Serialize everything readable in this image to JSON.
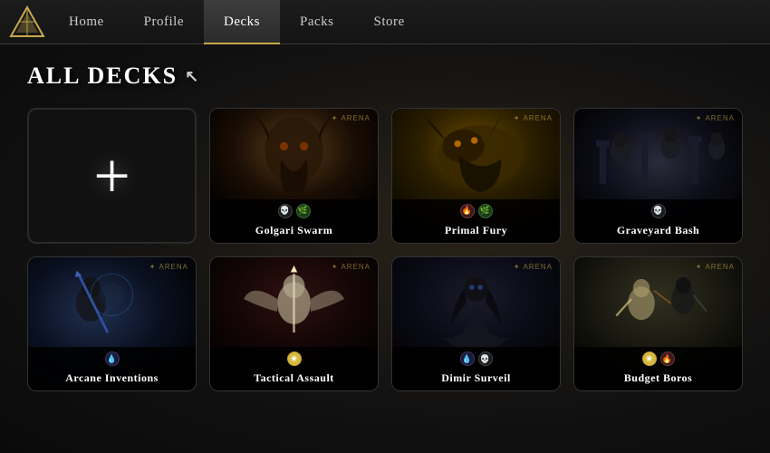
{
  "nav": {
    "logo_alt": "MTG Arena Logo",
    "items": [
      {
        "id": "home",
        "label": "Home",
        "active": false
      },
      {
        "id": "profile",
        "label": "Profile",
        "active": false
      },
      {
        "id": "decks",
        "label": "Decks",
        "active": true
      },
      {
        "id": "packs",
        "label": "Packs",
        "active": false
      },
      {
        "id": "store",
        "label": "Store",
        "active": false
      }
    ]
  },
  "main": {
    "section_title": "All Decks",
    "add_deck_label": "Add New Deck"
  },
  "decks": [
    {
      "id": "golgari-swarm",
      "name": "Golgari Swarm",
      "art_class": "art-golgari",
      "icons": [
        {
          "type": "skull",
          "label": "Black"
        },
        {
          "type": "green",
          "label": "Green"
        }
      ],
      "has_arena_badge": true
    },
    {
      "id": "primal-fury",
      "name": "Primal Fury",
      "art_class": "art-primal",
      "icons": [
        {
          "type": "red",
          "label": "Red"
        },
        {
          "type": "green",
          "label": "Green"
        }
      ],
      "has_arena_badge": true
    },
    {
      "id": "graveyard-bash",
      "name": "Graveyard Bash",
      "art_class": "art-graveyard",
      "icons": [
        {
          "type": "skull",
          "label": "Black"
        }
      ],
      "has_arena_badge": true
    },
    {
      "id": "arcane-inventions",
      "name": "Arcane Inventions",
      "art_class": "art-arcane",
      "icons": [
        {
          "type": "blue",
          "label": "Blue"
        }
      ],
      "has_arena_badge": true
    },
    {
      "id": "tactical-assault",
      "name": "Tactical Assault",
      "art_class": "art-tactical",
      "icons": [
        {
          "type": "sun",
          "label": "White"
        }
      ],
      "has_arena_badge": true
    },
    {
      "id": "dimir-surveil",
      "name": "Dimir Surveil",
      "art_class": "art-dimir",
      "icons": [
        {
          "type": "blue",
          "label": "Blue"
        },
        {
          "type": "skull",
          "label": "Black"
        }
      ],
      "has_arena_badge": true
    },
    {
      "id": "budget-boros",
      "name": "Budget Boros",
      "art_class": "art-boros",
      "icons": [
        {
          "type": "sun",
          "label": "White"
        },
        {
          "type": "red",
          "label": "Red"
        }
      ],
      "has_arena_badge": true
    }
  ],
  "icons": {
    "skull": "💀",
    "green": "🌿",
    "red": "🔥",
    "blue": "💧",
    "white": "☀",
    "sun": "☀",
    "arena_text": "ARENA",
    "arena_star": "✦",
    "cursor": "↖"
  },
  "colors": {
    "accent": "#c8a84b",
    "nav_bg": "#1c1c1c",
    "card_bg": "#1a1a1a",
    "active_tab": "#2a2a2a"
  }
}
